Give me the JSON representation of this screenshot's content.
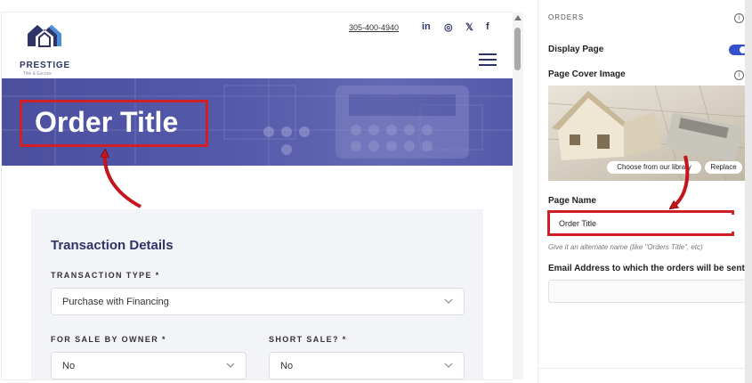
{
  "site": {
    "logo_name": "PRESTIGE",
    "logo_tagline": "Title & Escrow",
    "phone": "305-400-4940",
    "social": [
      "in",
      "◎",
      "𝕏",
      "f"
    ]
  },
  "hero": {
    "title": "Order Title"
  },
  "form": {
    "heading": "Transaction Details",
    "transaction_type_label": "TRANSACTION TYPE *",
    "transaction_type_value": "Purchase with Financing",
    "fsbo_label": "FOR SALE BY OWNER *",
    "fsbo_value": "No",
    "short_sale_label": "SHORT SALE? *",
    "short_sale_value": "No"
  },
  "panel": {
    "section": "ORDERS",
    "display_page_label": "Display Page",
    "display_page_on": true,
    "cover_image_label": "Page Cover Image",
    "choose_library_label": "Choose from our library",
    "replace_label": "Replace",
    "page_name_label": "Page Name",
    "page_name_value": "Order Title",
    "page_name_hint": "Give it an alternate name (like \"Orders Title\", etc)",
    "email_label": "Email Address to which the orders will be sent",
    "email_value": ""
  },
  "colors": {
    "brand": "#2e3566",
    "hero": "#5459aa",
    "highlight": "#d11f26",
    "toggle": "#3550c8"
  }
}
